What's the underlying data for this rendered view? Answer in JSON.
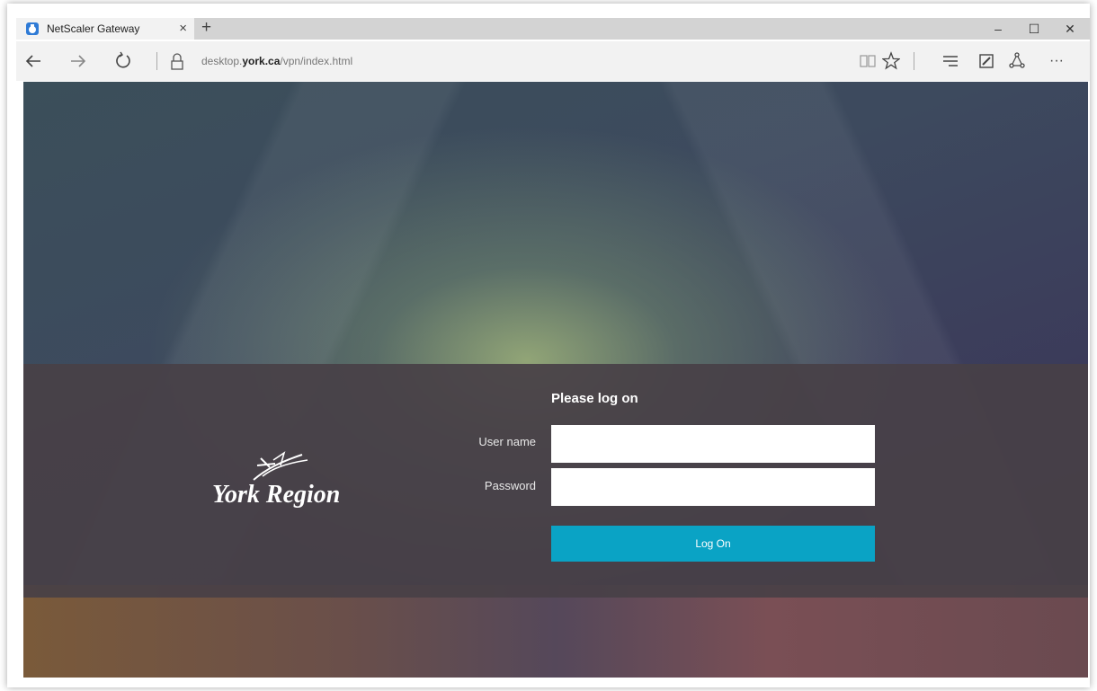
{
  "browser": {
    "tab_title": "NetScaler Gateway",
    "tab_close_glyph": "×",
    "new_tab_glyph": "+",
    "url_prefix": "desktop.",
    "url_domain": "york.ca",
    "url_path": "/vpn/index.html",
    "window_controls": {
      "minimize": "–",
      "maximize": "☐",
      "close": "✕"
    },
    "nav_icons": [
      "back-arrow-icon",
      "forward-arrow-icon",
      "refresh-icon",
      "lock-icon"
    ],
    "toolbar_icons": [
      "reading-view-icon",
      "favorite-star-icon",
      "hub-icon",
      "web-note-icon",
      "share-icon",
      "more-icon"
    ],
    "more_glyph": "···"
  },
  "login": {
    "logo_text": "York Region",
    "title": "Please log on",
    "username_label": "User name",
    "username_value": "",
    "password_label": "Password",
    "password_value": "",
    "logon_button": "Log On"
  },
  "colors": {
    "accent": "#0aa3c5"
  }
}
